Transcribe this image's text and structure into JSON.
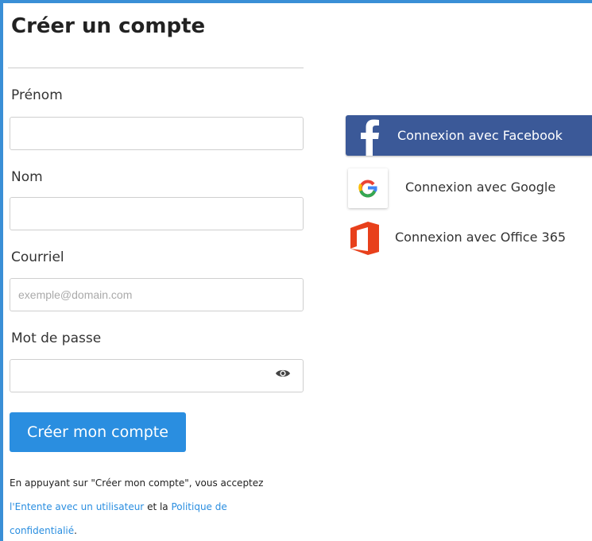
{
  "form": {
    "title": "Créer un compte",
    "first_name_label": "Prénom",
    "first_name_value": "",
    "last_name_label": "Nom",
    "last_name_value": "",
    "email_label": "Courriel",
    "email_placeholder": "exemple@domain.com",
    "password_label": "Mot de passe",
    "password_value": "",
    "submit_label": "Créer mon compte",
    "terms_line1": "En appuyant sur \"Créer mon compte\", vous acceptez",
    "terms_prefix": "l'",
    "terms_link1": "Entente avec un utilisateur",
    "terms_between": " et la ",
    "terms_link2_part1": "Politique de",
    "terms_link2_part2": "confidentialié",
    "terms_end": "."
  },
  "social": {
    "facebook_label": "Connexion avec Facebook",
    "google_label": "Connexion avec Google",
    "office_label": "Connexion avec Office 365"
  },
  "colors": {
    "accent": "#2a8ee0",
    "facebook": "#3b5998",
    "office": "#e8401b",
    "frame": "#3a8fd6"
  },
  "icons": [
    "password-visibility-icon",
    "facebook-logo-icon",
    "google-logo-icon",
    "office-logo-icon"
  ]
}
